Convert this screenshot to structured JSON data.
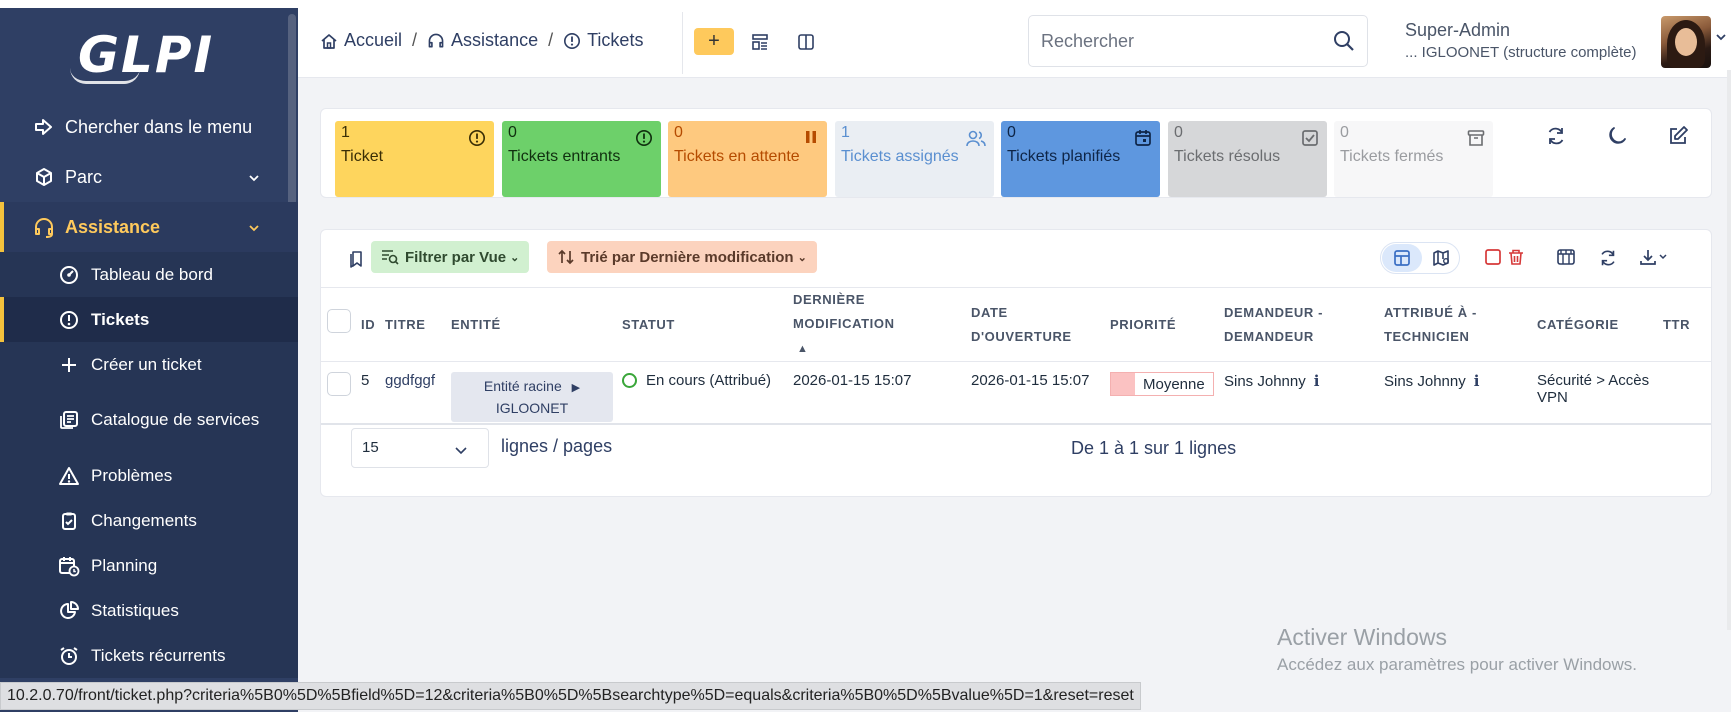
{
  "app": {
    "logo": "GLPI"
  },
  "sidebar": {
    "search_label": "Chercher dans le menu",
    "items": [
      {
        "label": "Parc",
        "icon": "cube-icon"
      },
      {
        "label": "Assistance",
        "icon": "headset-icon"
      }
    ],
    "sub_items": [
      {
        "label": "Tableau de bord",
        "icon": "gauge-icon"
      },
      {
        "label": "Tickets",
        "icon": "alert-circle-icon"
      },
      {
        "label": "Créer un ticket",
        "icon": "plus-icon"
      },
      {
        "label": "Catalogue de services",
        "icon": "catalog-icon"
      },
      {
        "label": "Problèmes",
        "icon": "warning-icon"
      },
      {
        "label": "Changements",
        "icon": "clipboard-check-icon"
      },
      {
        "label": "Planning",
        "icon": "calendar-clock-icon"
      },
      {
        "label": "Statistiques",
        "icon": "pie-chart-icon"
      },
      {
        "label": "Tickets récurrents",
        "icon": "alarm-icon"
      }
    ]
  },
  "header": {
    "breadcrumb": [
      "Accueil",
      "Assistance",
      "Tickets"
    ],
    "add_label": "+",
    "search_placeholder": "Rechercher",
    "user_name": "Super-Admin",
    "user_entity": "... IGLOONET (structure complète)"
  },
  "tiles": [
    {
      "count": "1",
      "label": "Ticket",
      "bg": "#fed55d",
      "fg": "#3a2e05"
    },
    {
      "count": "0",
      "label": "Tickets entrants",
      "bg": "#6dd06a",
      "fg": "#10300f"
    },
    {
      "count": "0",
      "label": "Tickets en attente",
      "bg": "#fec97f",
      "fg": "#b54b00"
    },
    {
      "count": "1",
      "label": "Tickets assignés",
      "bg": "#eaeef3",
      "fg": "#5a8fd0"
    },
    {
      "count": "0",
      "label": "Tickets planifiés",
      "bg": "#5e97df",
      "fg": "#0e2547"
    },
    {
      "count": "0",
      "label": "Tickets résolus",
      "bg": "#d6d7d9",
      "fg": "#6b6d70"
    },
    {
      "count": "0",
      "label": "Tickets fermés",
      "bg": "#f7f7f8",
      "fg": "#9a9ca0"
    }
  ],
  "list": {
    "filter_label": "Filtrer par Vue",
    "sort_label": "Trié par Dernière modification",
    "columns": [
      "ID",
      "TITRE",
      "ENTITÉ",
      "STATUT",
      "DERNIÈRE MODIFICATION",
      "DATE D'OUVERTURE",
      "PRIORITÉ",
      "DEMANDEUR - DEMANDEUR",
      "ATTRIBUÉ À - TECHNICIEN",
      "CATÉGORIE",
      "TTR"
    ],
    "rows": [
      {
        "id": "5",
        "title": "ggdfggf",
        "entity_line1": "Entité racine",
        "entity_line2": "IGLOONET",
        "status": "En cours (Attribué)",
        "last_modified": "2026-01-15 15:07",
        "opened": "2026-01-15 15:07",
        "priority": "Moyenne",
        "requester": "Sins Johnny",
        "technician": "Sins Johnny",
        "category": "Sécurité > Accès VPN"
      }
    ],
    "page_size": "15",
    "page_size_label": "lignes / pages",
    "pagination_info": "De 1 à 1 sur 1 lignes"
  },
  "watermark": {
    "line1": "Activer Windows",
    "line2": "Accédez aux paramètres pour activer Windows."
  },
  "status_url": "10.2.0.70/front/ticket.php?criteria%5B0%5D%5Bfield%5D=12&criteria%5B0%5D%5Bsearchtype%5D=equals&criteria%5B0%5D%5Bvalue%5D=1&reset=reset"
}
